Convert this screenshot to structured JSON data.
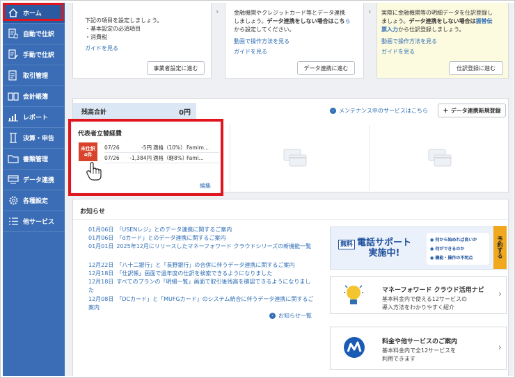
{
  "sidebar": {
    "items": [
      {
        "label": "ホーム",
        "icon": "home-icon"
      },
      {
        "label": "自動で仕訳",
        "icon": "auto-journal-icon"
      },
      {
        "label": "手動で仕訳",
        "icon": "manual-journal-icon"
      },
      {
        "label": "取引管理",
        "icon": "transaction-icon"
      },
      {
        "label": "会計帳簿",
        "icon": "ledger-icon"
      },
      {
        "label": "レポート",
        "icon": "report-icon"
      },
      {
        "label": "決算・申告",
        "icon": "settlement-icon"
      },
      {
        "label": "書類管理",
        "icon": "folder-icon"
      },
      {
        "label": "データ連携",
        "icon": "data-link-icon"
      },
      {
        "label": "各種設定",
        "icon": "gear-icon"
      },
      {
        "label": "他サービス",
        "icon": "list-icon"
      }
    ]
  },
  "steps": {
    "step1": {
      "line1": "下記の項目を設定しましょう。",
      "line2": "・基本設定の必須項目",
      "line3": "・消費税",
      "guide": "ガイドを見る",
      "button": "事業者設定に進む"
    },
    "step2": {
      "line1": "金融機関やクレジットカード等とデータ連携",
      "line2a": "しましょう。",
      "line2b": "データ連携をしない場合はこち",
      "line3a": "ら",
      "line3b": "から設定してください。",
      "video": "動画で操作方法を見る",
      "guide": "ガイドを見る",
      "button": "データ連携に進む"
    },
    "step3": {
      "line1": "実際に金融機関等の明細データを仕訳登録し",
      "line2a": "ましょう。",
      "line2b": "データ連携をしない場合は",
      "line2c": "振替伝",
      "line3a": "票入力",
      "line3b": "から仕訳登録しましょう。",
      "video": "動画で操作方法を見る",
      "guide": "ガイドを見る",
      "button": "仕訳登録に進む"
    }
  },
  "balance": {
    "label": "残高合計",
    "value": "0円",
    "maintenance": "メンテナンス中のサービスはこちら",
    "add_button": "データ連携新規登録"
  },
  "expense": {
    "title": "代表者立替経費",
    "badge_line1": "未仕訳",
    "badge_line2": "4件",
    "rows": [
      {
        "date": "07/26",
        "amount": "-5円",
        "tax": "適格（10%）",
        "payee": "Famim..."
      },
      {
        "date": "07/26",
        "amount": "-1,384円",
        "tax": "適格（軽8%）",
        "payee": "Fami..."
      }
    ],
    "edit": "編集"
  },
  "notices": {
    "title": "お知らせ",
    "items": [
      {
        "date": "01月06日",
        "text": "「USENレジ」とのデータ連携に関するご案内"
      },
      {
        "date": "01月06日",
        "text": "「dカード」とのデータ連携に関するご案内"
      },
      {
        "date": "01月01日",
        "text": "2025年12月にリリースしたマネーフォワード クラウドシリーズの新機能一覧"
      },
      {
        "date": "12月22日",
        "text": "「八十二銀行」と「長野銀行」の合併に伴うデータ連携に関するご案内"
      },
      {
        "date": "12月18日",
        "text": "「仕訳帳」画面で過年度の仕訳を検索できるようになりました"
      },
      {
        "date": "12月18日",
        "text": "すべてのプランの「明細一覧」画面で取引後残高を確認できるようになりました"
      },
      {
        "date": "12月08日",
        "text": "「DCカード」と「MUFGカード」のシステム統合に伴うデータ連携に関するご案内"
      }
    ],
    "more": "お知らせ一覧"
  },
  "promo": {
    "tag": "無料",
    "title_line1": "電話サポート",
    "title_line2": "実施中!",
    "bullets": [
      "何から始めれば良いか",
      "何ができるのか",
      "機能・操作の不明点"
    ],
    "side": "予約する"
  },
  "nav_cards": [
    {
      "title": "マネーフォワード クラウド活用ナビ",
      "desc1": "基本料金内で使える12サービスの",
      "desc2": "導入方法をわかりやすく紹介"
    },
    {
      "title": "料金や他サービスのご案内",
      "desc1": "基本料金内で全12サービスを",
      "desc2": "利用できます"
    }
  ],
  "colors": {
    "sidebar": "#3a6db5",
    "highlight": "#e0161e",
    "link": "#2f6eb5",
    "badge": "#d9432b",
    "promo_tab": "#f0a81e"
  }
}
